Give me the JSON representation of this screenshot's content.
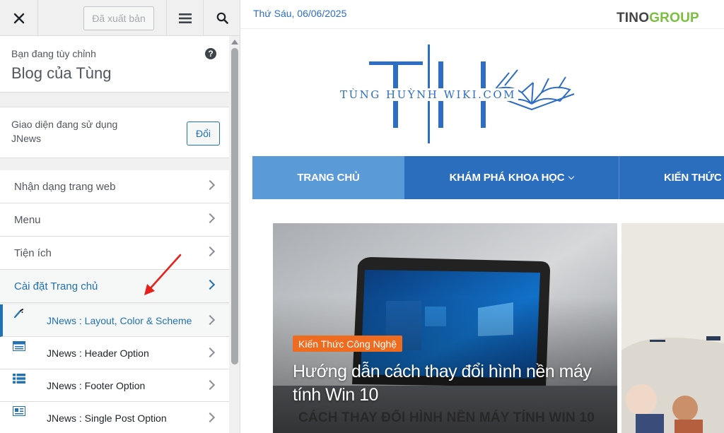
{
  "customizer": {
    "close_icon": "close-icon",
    "publish_label": "Đã xuất bản",
    "menu_icon": "hamburger-icon",
    "search_icon": "search-icon",
    "info": {
      "label": "Bạn đang tùy chỉnh",
      "site_title": "Blog của Tùng",
      "help_icon": "help-icon",
      "help_glyph": "?"
    },
    "theme": {
      "label": "Giao diện đang sử dụng",
      "name": "JNews",
      "change_label": "Đổi"
    },
    "panels": [
      {
        "label": "Nhận dạng trang web"
      },
      {
        "label": "Menu"
      },
      {
        "label": "Tiện ích"
      },
      {
        "label": "Cài đặt Trang chủ"
      }
    ],
    "subpanels": [
      {
        "label": "JNews : Layout, Color & Scheme",
        "icon": "paintbrush-icon"
      },
      {
        "label": "JNews : Header Option",
        "icon": "header-layout-icon"
      },
      {
        "label": "JNews : Footer Option",
        "icon": "footer-list-icon"
      },
      {
        "label": "JNews : Single Post Option",
        "icon": "single-post-icon"
      }
    ],
    "accent_color": "#2271b1",
    "annotation_color": "#e8201b"
  },
  "preview": {
    "date": "Thứ Sáu, 06/06/2025",
    "brand_part1": "TINO",
    "brand_part2": "GROUP",
    "logo": {
      "letters": "TH",
      "text": "TÙNG HUỲNH WIKI.COM"
    },
    "nav": [
      {
        "label": "TRANG CHỦ"
      },
      {
        "label": "KHÁM PHÁ KHOA HỌC"
      },
      {
        "label": "KIẾN THỨC"
      }
    ],
    "feature": {
      "category": "Kiến Thức Công Nghệ",
      "title": "Hướng dẫn cách thay đổi hình nền máy tính Win 10",
      "caption": "CÁCH THAY ĐỔI HÌNH NỀN MÁY TÍNH WIN 10"
    },
    "nav_color": "#2a6ebd",
    "badge_color": "#ef6b1f"
  }
}
